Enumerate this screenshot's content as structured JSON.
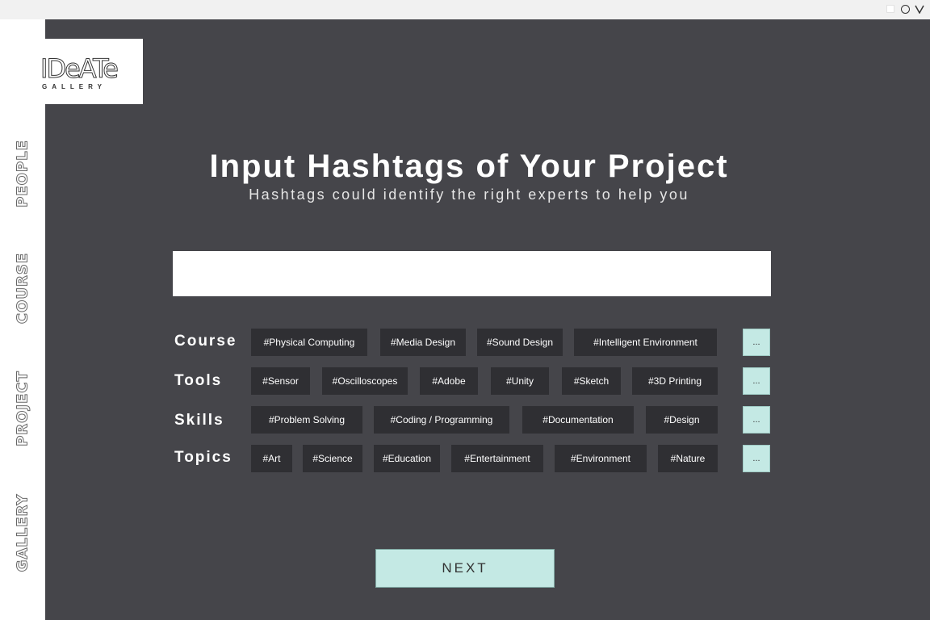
{
  "window_controls": [
    {
      "name": "restore",
      "icon": "square-icon"
    },
    {
      "name": "circle",
      "icon": "circle-icon"
    },
    {
      "name": "chevron",
      "icon": "chevron-down-icon"
    }
  ],
  "logo": {
    "title": "IDeATe",
    "subtitle": "GALLERY"
  },
  "sidebar": {
    "items": [
      {
        "label": "PEOPLE"
      },
      {
        "label": "COURSE"
      },
      {
        "label": "PROJECT"
      },
      {
        "label": "GALLERY"
      }
    ]
  },
  "main": {
    "title": "Input Hashtags of Your Project",
    "subtitle": "Hashtags could identify the right experts to help you",
    "input_value": "",
    "rows": [
      {
        "label": "Course",
        "tags": [
          "#Physical Computing",
          "#Media Design",
          "#Sound Design",
          "#Intelligent Environment"
        ],
        "more": "..."
      },
      {
        "label": "Tools",
        "tags": [
          "#Sensor",
          "#Oscilloscopes",
          "#Adobe",
          "#Unity",
          "#Sketch",
          "#3D Printing"
        ],
        "more": "..."
      },
      {
        "label": "Skills",
        "tags": [
          "#Problem Solving",
          "#Coding / Programming",
          "#Documentation",
          "#Design"
        ],
        "more": "..."
      },
      {
        "label": "Topics",
        "tags": [
          "#Art",
          "#Science",
          "#Education",
          "#Entertainment",
          "#Environment",
          "#Nature"
        ],
        "more": "..."
      }
    ],
    "next_label": "NEXT"
  },
  "colors": {
    "main_bg": "#45454a",
    "tag_bg": "#2f2f33",
    "accent": "#c4e9e4",
    "topbar": "#f1f1f1"
  }
}
